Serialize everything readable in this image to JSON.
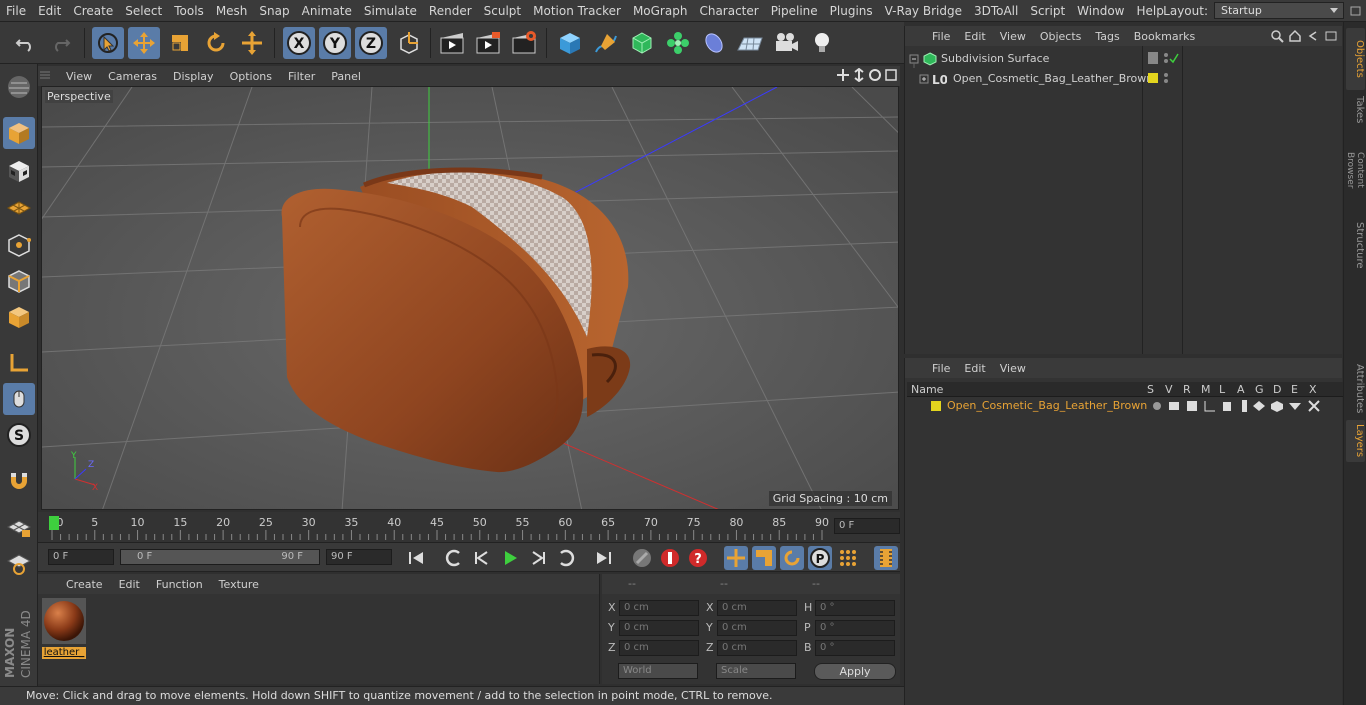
{
  "menubar": {
    "items": [
      "File",
      "Edit",
      "Create",
      "Select",
      "Tools",
      "Mesh",
      "Snap",
      "Animate",
      "Simulate",
      "Render",
      "Sculpt",
      "Motion Tracker",
      "MoGraph",
      "Character",
      "Pipeline",
      "Plugins",
      "V-Ray Bridge",
      "3DToAll",
      "Script",
      "Window",
      "Help"
    ],
    "layout_label": "Layout:",
    "layout_value": "Startup"
  },
  "viewport": {
    "menu": [
      "View",
      "Cameras",
      "Display",
      "Options",
      "Filter",
      "Panel"
    ],
    "name": "Perspective",
    "grid_spacing": "Grid Spacing : 10 cm"
  },
  "timeline": {
    "ticks": [
      "0",
      "5",
      "10",
      "15",
      "20",
      "25",
      "30",
      "35",
      "40",
      "45",
      "50",
      "55",
      "60",
      "65",
      "70",
      "75",
      "80",
      "85",
      "90"
    ],
    "current_frame": "0 F"
  },
  "playbar": {
    "start": "0 F",
    "range_start": "0 F",
    "range_end": "90 F",
    "end": "90 F"
  },
  "material": {
    "menu": [
      "Create",
      "Edit",
      "Function",
      "Texture"
    ],
    "items": [
      {
        "name": "leather_"
      }
    ]
  },
  "attributes": {
    "headers": [
      "--",
      "--",
      "--"
    ],
    "rows": [
      [
        {
          "label": "X",
          "value": "0 cm"
        },
        {
          "label": "X",
          "value": "0 cm"
        },
        {
          "label": "H",
          "value": "0 °"
        }
      ],
      [
        {
          "label": "Y",
          "value": "0 cm"
        },
        {
          "label": "Y",
          "value": "0 cm"
        },
        {
          "label": "P",
          "value": "0 °"
        }
      ],
      [
        {
          "label": "Z",
          "value": "0 cm"
        },
        {
          "label": "Z",
          "value": "0 cm"
        },
        {
          "label": "B",
          "value": "0 °"
        }
      ]
    ],
    "coord_mode": "World",
    "size_mode": "Scale",
    "apply": "Apply"
  },
  "status": "Move: Click and drag to move elements. Hold down SHIFT to quantize movement / add to the selection in point mode, CTRL to remove.",
  "objects": {
    "menu": [
      "File",
      "Edit",
      "View",
      "Objects",
      "Tags",
      "Bookmarks"
    ],
    "tree": [
      {
        "name": "Subdivision Surface"
      },
      {
        "name": "Open_Cosmetic_Bag_Leather_Brown"
      }
    ]
  },
  "layers": {
    "menu": [
      "File",
      "Edit",
      "View"
    ],
    "columns": [
      "Name",
      "S",
      "V",
      "R",
      "M",
      "L",
      "A",
      "G",
      "D",
      "E",
      "X"
    ],
    "rows": [
      {
        "name": "Open_Cosmetic_Bag_Leather_Brown",
        "color": "#e3d51e"
      }
    ]
  },
  "side_tabs": [
    "Objects",
    "Takes",
    "Content Browser",
    "Structure",
    "Attributes",
    "Layers"
  ],
  "colors": {
    "accent": "#5a7ca8",
    "highlight": "#e8a335",
    "layer_yellow": "#e3d51e"
  }
}
